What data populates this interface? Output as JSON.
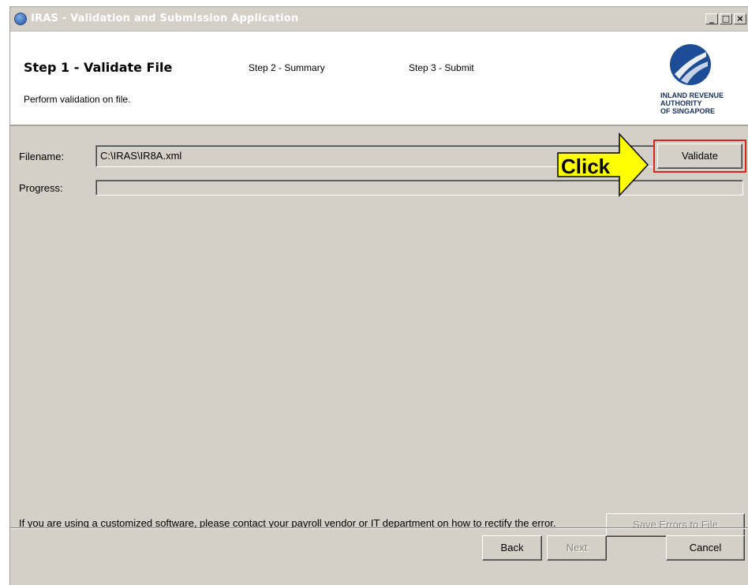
{
  "window": {
    "title": "IRAS - Validation and Submission Application",
    "controls": [
      "_",
      "□",
      "×"
    ]
  },
  "header": {
    "steps": [
      "Step 1 - Validate File",
      "Step 2 - Summary",
      "Step 3 - Submit"
    ],
    "subtitle": "Perform validation on file.",
    "logo_lines": [
      "INLAND REVENUE",
      "AUTHORITY",
      "OF SINGAPORE"
    ]
  },
  "form": {
    "filename_label": "Filename:",
    "filename_value": "C:\\IRAS\\IR8A.xml",
    "progress_label": "Progress:",
    "progress_value": 0,
    "validate_label": "Validate"
  },
  "annotation": {
    "callout": "Click",
    "highlight_color": "#e02020",
    "callout_fill": "#ffff00"
  },
  "footer": {
    "note": "If you are using a customized software, please contact your payroll vendor or IT department on how to rectify the error.",
    "save_errors_label": "Save Errors to File",
    "back_label": "Back",
    "next_label": "Next",
    "cancel_label": "Cancel"
  }
}
